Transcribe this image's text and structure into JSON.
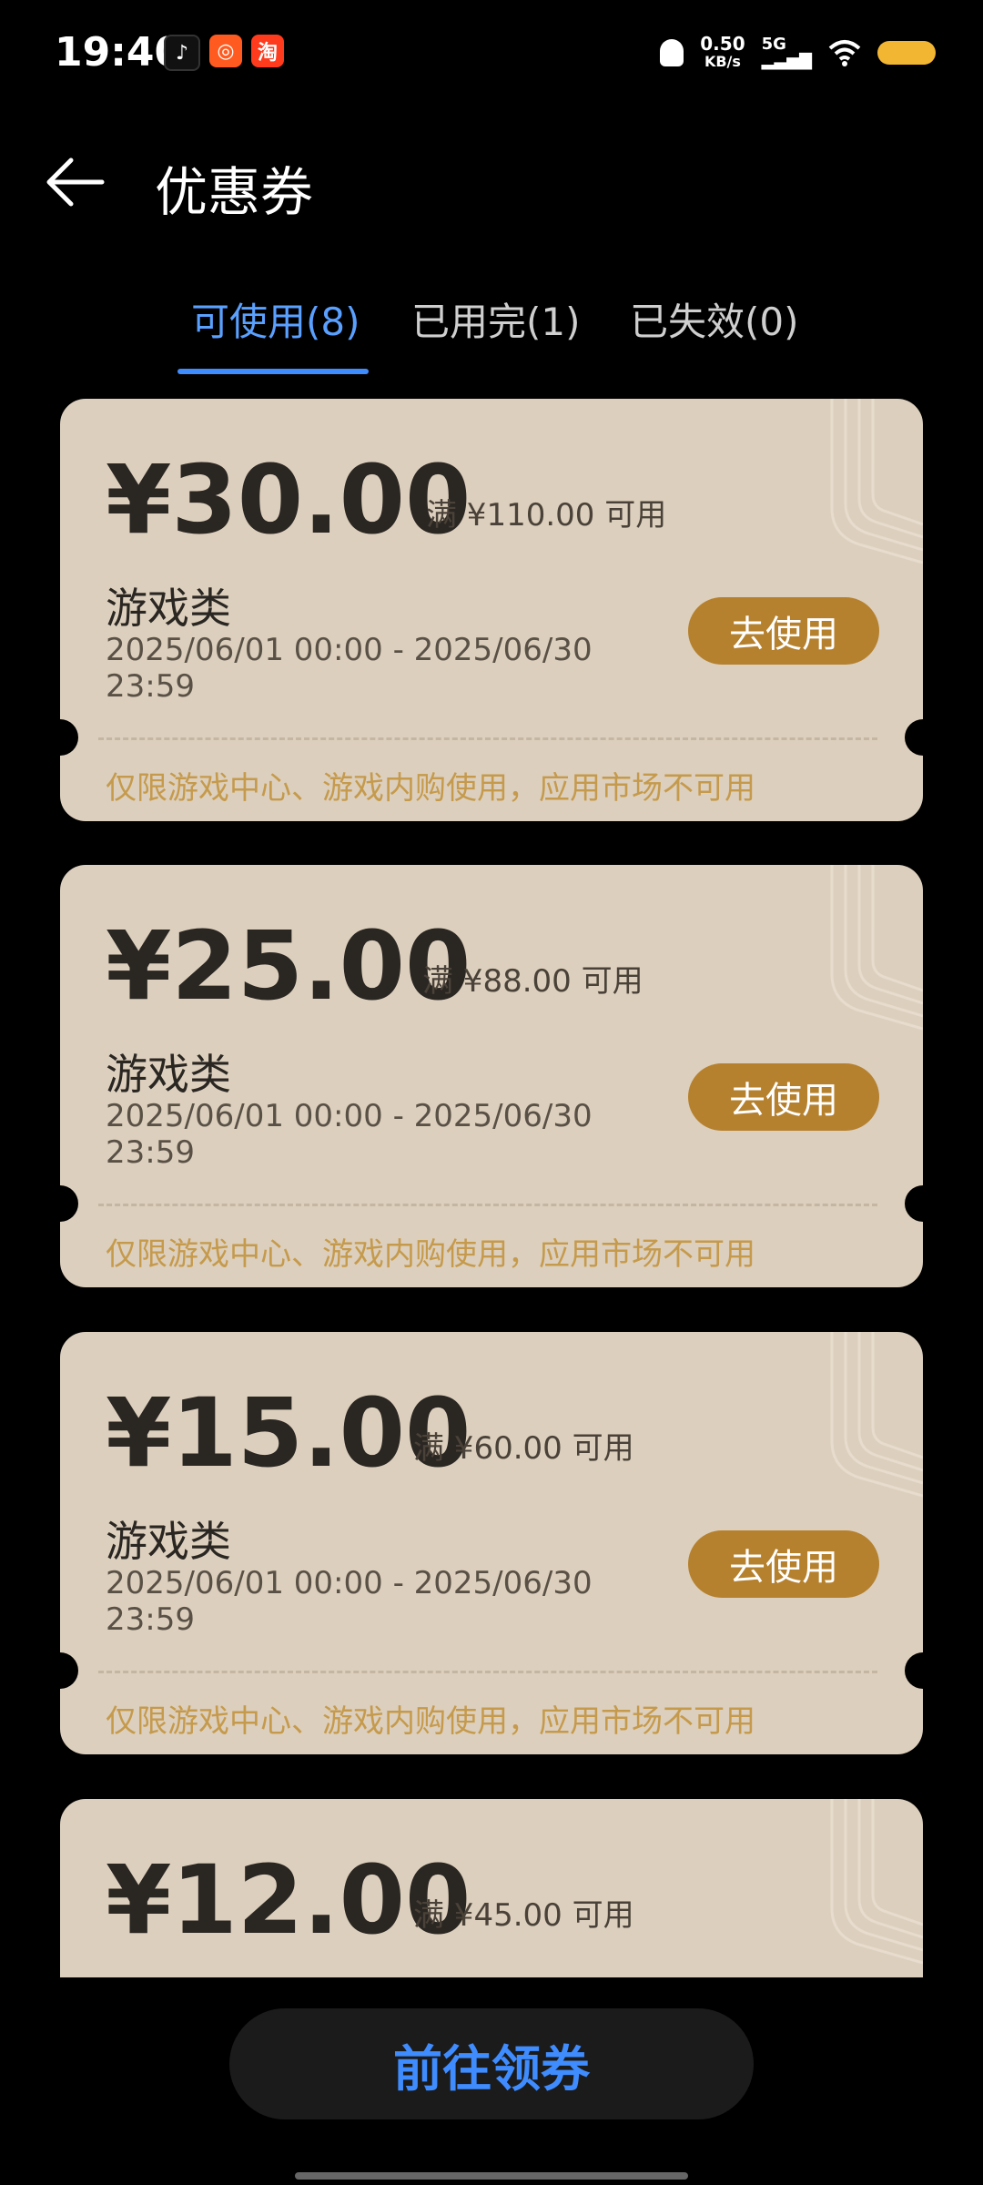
{
  "status_bar": {
    "time": "19:40",
    "net_speed_value": "0.50",
    "net_speed_unit": "KB/s",
    "signal_label": "5G"
  },
  "header": {
    "title": "优惠券"
  },
  "tabs": [
    {
      "label": "可使用(8)",
      "active": true
    },
    {
      "label": "已用完(1)",
      "active": false
    },
    {
      "label": "已失效(0)",
      "active": false
    }
  ],
  "coupons": [
    {
      "amount": "¥30.00",
      "min_spend": "满 ¥110.00 可用",
      "type": "游戏类",
      "validity": "2025/06/01 00:00 - 2025/06/30 23:59",
      "button": "去使用",
      "note": "仅限游戏中心、游戏内购使用，应用市场不可用"
    },
    {
      "amount": "¥25.00",
      "min_spend": "满 ¥88.00 可用",
      "type": "游戏类",
      "validity": "2025/06/01 00:00 - 2025/06/30 23:59",
      "button": "去使用",
      "note": "仅限游戏中心、游戏内购使用，应用市场不可用"
    },
    {
      "amount": "¥15.00",
      "min_spend": "满 ¥60.00 可用",
      "type": "游戏类",
      "validity": "2025/06/01 00:00 - 2025/06/30 23:59",
      "button": "去使用",
      "note": "仅限游戏中心、游戏内购使用，应用市场不可用"
    },
    {
      "amount": "¥12.00",
      "min_spend": "满 ¥45.00 可用"
    }
  ],
  "bottom_button": {
    "label": "前往领券"
  },
  "colors": {
    "accent_blue": "#3f8cff",
    "coupon_bg": "#dccfbd",
    "use_button": "#b5812e",
    "note_text": "#c59a4c"
  }
}
